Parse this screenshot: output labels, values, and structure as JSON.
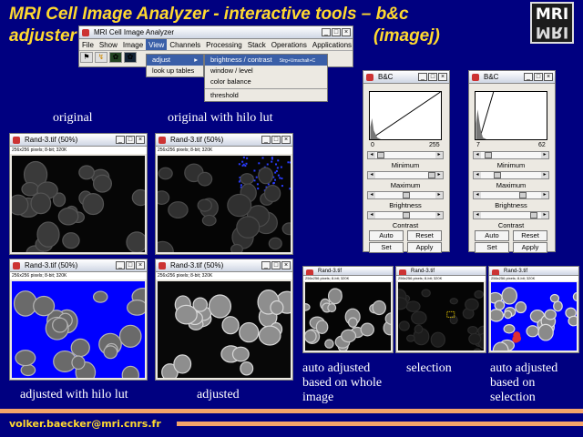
{
  "slide": {
    "title_line1": "MRI Cell Image Analyzer - interactive tools – b&c",
    "title_line2": "adjuster",
    "title_suffix": "(imagej)",
    "logo_text": "MRI",
    "footer_email": "volker.baecker@mri.cnrs.fr"
  },
  "imagej": {
    "window_title": "MRI Cell Image Analyzer",
    "menus": [
      "File",
      "Show",
      "Image",
      "View",
      "Channels",
      "Processing",
      "Stack",
      "Operations",
      "Applications"
    ],
    "selected_menu": "View",
    "view_menu_items": [
      "adjust",
      "look up tables"
    ],
    "adjust_submenu": [
      "brightness / contrast",
      "window / level",
      "color balance",
      "threshold"
    ],
    "adjust_shortcut": "Strg+Umschalt+C"
  },
  "image_windows": {
    "title": "Rand-3.tif (50%)",
    "info": "256x256 pixels; 8-bit; 320K",
    "small_title": "Rand-3.tif"
  },
  "captions": {
    "original": "original",
    "original_hilo": "original with hilo lut",
    "adjusted_hilo": "adjusted with hilo lut",
    "adjusted": "adjusted",
    "auto_whole_1": "auto adjusted",
    "auto_whole_2": "based on whole",
    "auto_whole_3": "image",
    "selection": "selection",
    "auto_sel_1": "auto adjusted",
    "auto_sel_2": "based on",
    "auto_sel_3": "selection"
  },
  "bc_panels": [
    {
      "title": "B&C",
      "min": "0",
      "max": "255",
      "labels": [
        "Minimum",
        "Maximum",
        "Brightness",
        "Contrast"
      ],
      "buttons": [
        "Auto",
        "Reset",
        "Set",
        "Apply"
      ]
    },
    {
      "title": "B&C",
      "min": "7",
      "max": "62",
      "labels": [
        "Minimum",
        "Maximum",
        "Brightness",
        "Contrast"
      ],
      "buttons": [
        "Auto",
        "Reset",
        "Set",
        "Apply"
      ]
    }
  ],
  "colors": {
    "title_yellow": "#ffd92f",
    "background": "#000080",
    "hilo_blue": "#0000ff",
    "footer_bar": "#f4a46a"
  }
}
